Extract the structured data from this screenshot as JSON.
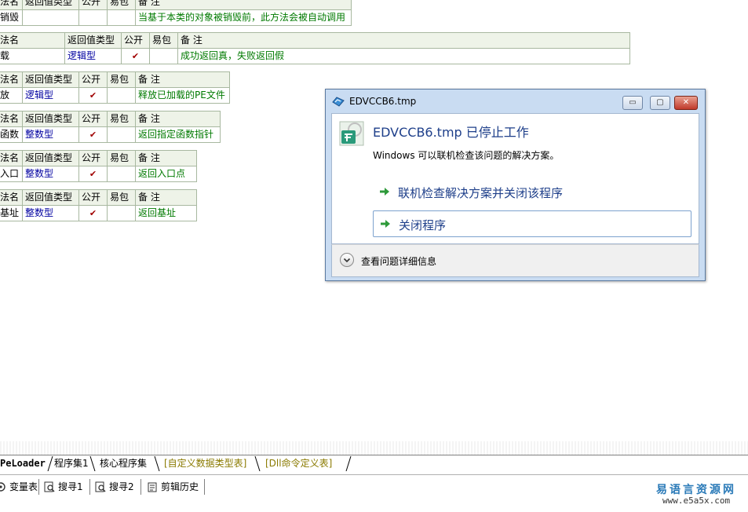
{
  "tables": [
    {
      "header": [
        "法名",
        "返回值类型",
        "公开",
        "易包",
        "备 注"
      ],
      "row": [
        "销毁",
        "",
        "",
        "",
        "当基于本类的对象被销毁前，此方法会被自动调用"
      ]
    },
    {
      "header": [
        "法名",
        "返回值类型",
        "公开",
        "易包",
        "备 注"
      ],
      "row": [
        "载",
        "逻辑型",
        "✔",
        "",
        "成功返回真，失败返回假"
      ]
    },
    {
      "header": [
        "法名",
        "返回值类型",
        "公开",
        "易包",
        "备 注"
      ],
      "row": [
        "放",
        "逻辑型",
        "✔",
        "",
        "释放已加载的PE文件"
      ]
    },
    {
      "header": [
        "法名",
        "返回值类型",
        "公开",
        "易包",
        "备 注"
      ],
      "row": [
        "函数",
        "整数型",
        "✔",
        "",
        "返回指定函数指针"
      ]
    },
    {
      "header": [
        "法名",
        "返回值类型",
        "公开",
        "易包",
        "备 注"
      ],
      "row": [
        "入口",
        "整数型",
        "✔",
        "",
        "返回入口点"
      ]
    },
    {
      "header": [
        "法名",
        "返回值类型",
        "公开",
        "易包",
        "备 注"
      ],
      "row": [
        "基址",
        "整数型",
        "✔",
        "",
        "返回基址"
      ]
    }
  ],
  "dialog": {
    "title": "EDVCCB6.tmp",
    "heading": "EDVCCB6.tmp 已停止工作",
    "subtext": "Windows 可以联机检查该问题的解决方案。",
    "option1": "联机检查解决方案并关闭该程序",
    "option2": "关闭程序",
    "details": "查看问题详细信息",
    "min_glyph": "▭",
    "max_glyph": "▢",
    "close_glyph": "✕"
  },
  "tabs": [
    "PeLoader",
    "程序集1",
    "核心程序集",
    "[自定义数据类型表]",
    "[Dll命令定义表]"
  ],
  "toolbar": [
    "变量表",
    "搜寻1",
    "搜寻2",
    "剪辑历史"
  ],
  "watermark": {
    "line1": "易语言资源网",
    "line2": "www.e5a5x.com"
  },
  "colors": {
    "dialog_frame": "#c9dcf2",
    "link_blue": "#1e3f8a",
    "note_green": "#007a00",
    "type_blue": "#0000a0"
  }
}
